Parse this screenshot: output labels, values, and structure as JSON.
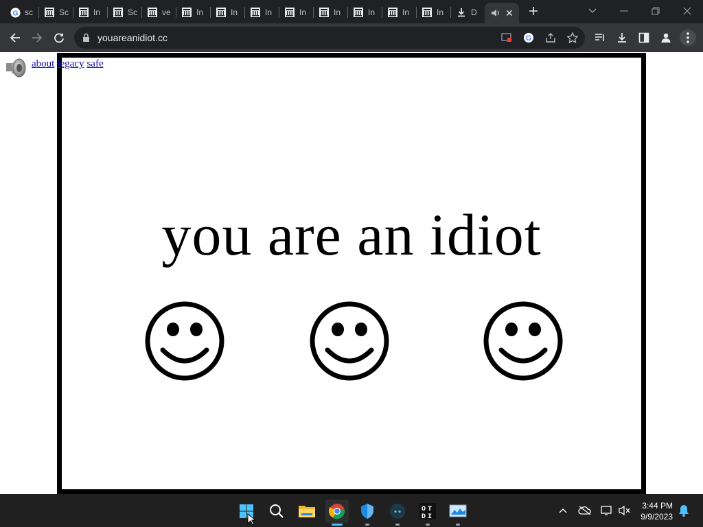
{
  "browser": {
    "tabs": [
      {
        "label": "sc",
        "icon": "google-icon"
      },
      {
        "label": "Sc",
        "icon": "museum-icon"
      },
      {
        "label": "In",
        "icon": "museum-icon"
      },
      {
        "label": "Sc",
        "icon": "museum-icon"
      },
      {
        "label": "ve",
        "icon": "museum-icon"
      },
      {
        "label": "In",
        "icon": "museum-icon"
      },
      {
        "label": "In",
        "icon": "museum-icon"
      },
      {
        "label": "In",
        "icon": "museum-icon"
      },
      {
        "label": "In",
        "icon": "museum-icon"
      },
      {
        "label": "In",
        "icon": "museum-icon"
      },
      {
        "label": "In",
        "icon": "museum-icon"
      },
      {
        "label": "In",
        "icon": "museum-icon"
      },
      {
        "label": "In",
        "icon": "museum-icon"
      },
      {
        "label": "D",
        "icon": "download-icon"
      }
    ],
    "active_tab_icon": "speaker-icon",
    "url": "youareanidiot.cc"
  },
  "page": {
    "links": [
      "about",
      "legacy",
      "safe"
    ],
    "headline": "you are an idiot",
    "smiley_count": 3
  },
  "taskbar": {
    "apps": [
      "start-icon",
      "search-icon",
      "file-explorer-icon",
      "chrome-icon",
      "defender-icon",
      "app-icon",
      "terminal-icon",
      "monitor-icon"
    ],
    "time": "3:44 PM",
    "date": "9/9/2023"
  },
  "colors": {
    "tabstrip": "#202124",
    "toolbar": "#35363a",
    "link": "#1a0dab",
    "taskbar": "#202020",
    "accent": "#4cc2ff"
  }
}
